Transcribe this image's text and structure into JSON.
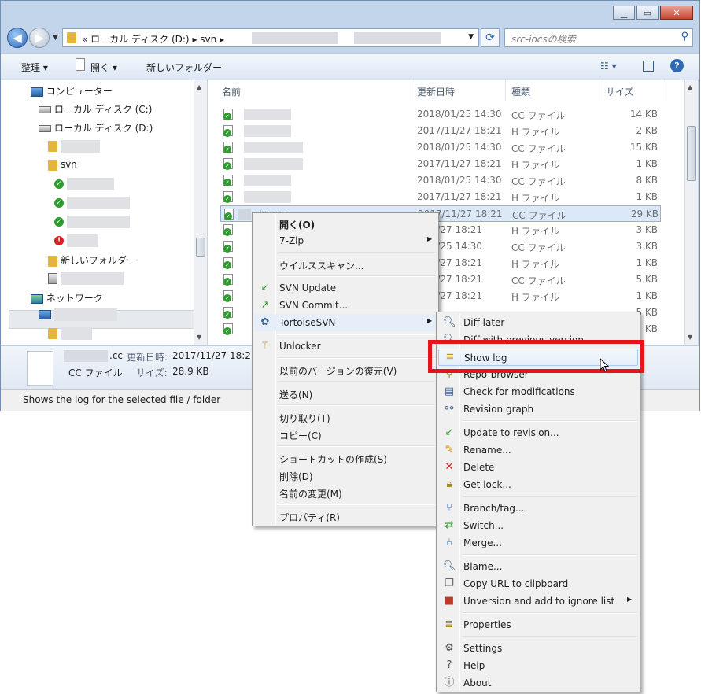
{
  "address": {
    "root_label": "ローカル ディスク (D:)",
    "folder": "svn",
    "chevrons": [
      "«",
      "▸",
      "▸",
      "▸"
    ]
  },
  "search": {
    "placeholder": "src-iocsの検索"
  },
  "toolbar": {
    "organize": "整理 ▾",
    "open": "開く ▾",
    "new_folder": "新しいフォルダー"
  },
  "tree": {
    "computer": "コンピューター",
    "drive_c": "ローカル ディスク (C:)",
    "drive_d": "ローカル ディスク (D:)",
    "svn": "svn",
    "new_folder": "新しいフォルダー",
    "network": "ネットワーク"
  },
  "columns": {
    "name": "名前",
    "date": "更新日時",
    "type": "種類",
    "size": "サイズ"
  },
  "files": [
    {
      "date": "2018/01/25 14:30",
      "type": "CC ファイル",
      "size": "14 KB"
    },
    {
      "date": "2017/11/27 18:21",
      "type": "H ファイル",
      "size": "2 KB"
    },
    {
      "date": "2018/01/25 14:30",
      "type": "CC ファイル",
      "size": "15 KB"
    },
    {
      "date": "2017/11/27 18:21",
      "type": "H ファイル",
      "size": "1 KB"
    },
    {
      "date": "2018/01/25 14:30",
      "type": "CC ファイル",
      "size": "8 KB"
    },
    {
      "date": "2017/11/27 18:21",
      "type": "H ファイル",
      "size": "1 KB"
    },
    {
      "name_suffix": "_lan.cc",
      "date": "2017/11/27 18:21",
      "type": "CC ファイル",
      "size": "29 KB"
    },
    {
      "date": "/11/27 18:21",
      "type": "H ファイル",
      "size": "3 KB"
    },
    {
      "date": "/01/25 14:30",
      "type": "CC ファイル",
      "size": "3 KB"
    },
    {
      "date": "/11/27 18:21",
      "type": "H ファイル",
      "size": "1 KB"
    },
    {
      "date": "/11/27 18:21",
      "type": "CC ファイル",
      "size": "5 KB"
    },
    {
      "date": "/11/27 18:21",
      "type": "H ファイル",
      "size": "1 KB"
    },
    {
      "date": "",
      "type": "",
      "size": "5 KB"
    },
    {
      "date": "",
      "type": "",
      "size": "KB"
    }
  ],
  "details": {
    "filename_suffix": ".cc",
    "modified_label": "更新日時:",
    "modified_value": "2017/11/27 18:21",
    "type": "CC ファイル",
    "size_label": "サイズ:",
    "size_value": "28.9 KB"
  },
  "status": "Shows the log for the selected file / folder",
  "context_menu": [
    {
      "label": "開く(O)"
    },
    {
      "label": "7-Zip"
    },
    {
      "label": "ウイルススキャン..."
    },
    {
      "label": "SVN Update"
    },
    {
      "label": "SVN Commit..."
    },
    {
      "label": "TortoiseSVN"
    },
    {
      "label": "Unlocker"
    },
    {
      "label": "以前のバージョンの復元(V)"
    },
    {
      "label": "送る(N)"
    },
    {
      "label": "切り取り(T)"
    },
    {
      "label": "コピー(C)"
    },
    {
      "label": "ショートカットの作成(S)"
    },
    {
      "label": "削除(D)"
    },
    {
      "label": "名前の変更(M)"
    },
    {
      "label": "プロパティ(R)"
    }
  ],
  "tortoise_menu": [
    {
      "label": "Diff later"
    },
    {
      "label": "Diff with previous version"
    },
    {
      "label": "Show log"
    },
    {
      "label": "Repo-browser"
    },
    {
      "label": "Check for modifications"
    },
    {
      "label": "Revision graph"
    },
    {
      "label": "Update to revision..."
    },
    {
      "label": "Rename..."
    },
    {
      "label": "Delete"
    },
    {
      "label": "Get lock..."
    },
    {
      "label": "Branch/tag..."
    },
    {
      "label": "Switch..."
    },
    {
      "label": "Merge..."
    },
    {
      "label": "Blame..."
    },
    {
      "label": "Copy URL to clipboard"
    },
    {
      "label": "Unversion and add to ignore list"
    },
    {
      "label": "Properties"
    },
    {
      "label": "Settings"
    },
    {
      "label": "Help"
    },
    {
      "label": "About"
    }
  ],
  "colors": {
    "highlight_box": "#e8141c",
    "accent": "#2e6ab8"
  }
}
